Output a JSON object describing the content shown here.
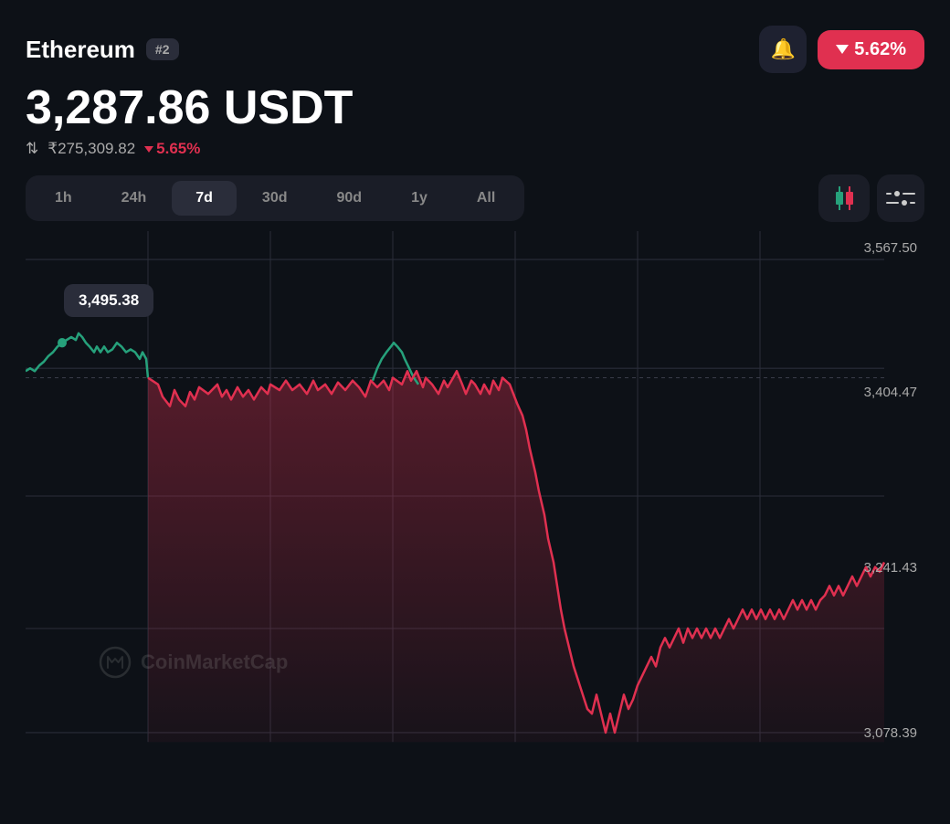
{
  "header": {
    "coin_name": "Ethereum",
    "rank": "#2",
    "price": "3,287.86 USDT",
    "price_inr": "₹275,309.82",
    "change_pct_inr": "5.65%",
    "change_pct_usd": "5.62%",
    "bell_icon": "bell-icon",
    "change_direction": "down"
  },
  "tabs": {
    "items": [
      "1h",
      "24h",
      "7d",
      "30d",
      "90d",
      "1y",
      "All"
    ],
    "active": "7d"
  },
  "chart": {
    "tooltip_value": "3,495.38",
    "price_labels": {
      "top": "3,567.50",
      "mid_high": "3,404.47",
      "mid_low": "3,241.43",
      "bottom": "3,078.39"
    },
    "watermark": "CoinMarketCap"
  },
  "icons": {
    "bell": "🔔",
    "arrow_down_tri": "▼"
  }
}
